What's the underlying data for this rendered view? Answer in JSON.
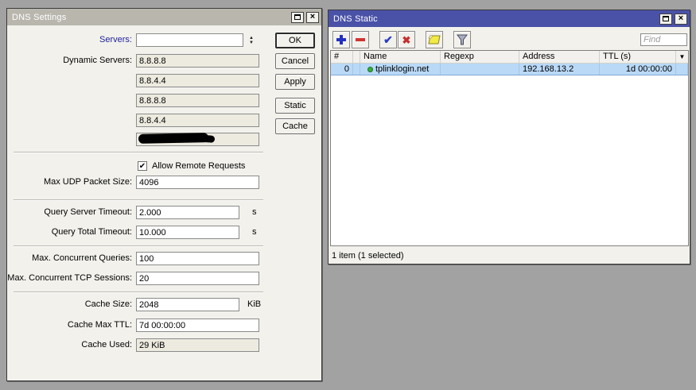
{
  "icons": {
    "close": "×",
    "check": "✔",
    "cross": "✖",
    "spinner_up": "▲",
    "spinner_down": "▼",
    "sort_dropdown": "▼",
    "checkbox_check": "✔"
  },
  "dns_settings": {
    "title": "DNS Settings",
    "servers_label": "Servers:",
    "servers_value": "",
    "dynamic_servers_label": "Dynamic Servers:",
    "dynamic_servers": [
      "8.8.8.8",
      "8.8.4.4",
      "8.8.8.8",
      "8.8.4.4",
      ""
    ],
    "allow_remote_label": "Allow Remote Requests",
    "allow_remote_checked": true,
    "max_udp_label": "Max UDP Packet Size:",
    "max_udp_value": "4096",
    "query_server_timeout_label": "Query Server Timeout:",
    "query_server_timeout_value": "2.000",
    "query_server_timeout_unit": "s",
    "query_total_timeout_label": "Query Total Timeout:",
    "query_total_timeout_value": "10.000",
    "query_total_timeout_unit": "s",
    "max_concurrent_queries_label": "Max. Concurrent Queries:",
    "max_concurrent_queries_value": "100",
    "max_concurrent_tcp_label": "Max. Concurrent TCP Sessions:",
    "max_concurrent_tcp_value": "20",
    "cache_size_label": "Cache Size:",
    "cache_size_value": "2048",
    "cache_size_unit": "KiB",
    "cache_max_ttl_label": "Cache Max TTL:",
    "cache_max_ttl_value": "7d 00:00:00",
    "cache_used_label": "Cache Used:",
    "cache_used_value": "29 KiB",
    "buttons": {
      "ok": "OK",
      "cancel": "Cancel",
      "apply": "Apply",
      "static": "Static",
      "cache": "Cache"
    }
  },
  "dns_static": {
    "title": "DNS Static",
    "find_placeholder": "Find",
    "columns": {
      "num": "#",
      "name": "Name",
      "regexp": "Regexp",
      "address": "Address",
      "ttl": "TTL (s)"
    },
    "rows": [
      {
        "num": "0",
        "name": "tplinklogin.net",
        "regexp": "",
        "address": "192.168.13.2",
        "ttl": "1d 00:00:00",
        "selected": true
      }
    ],
    "status": "1 item (1 selected)"
  },
  "colors": {
    "active_titlebar": "#4a52a8",
    "inactive_titlebar": "#b9b6ae",
    "selection": "#b9d9f7",
    "desktop": "#a2a2a2"
  }
}
